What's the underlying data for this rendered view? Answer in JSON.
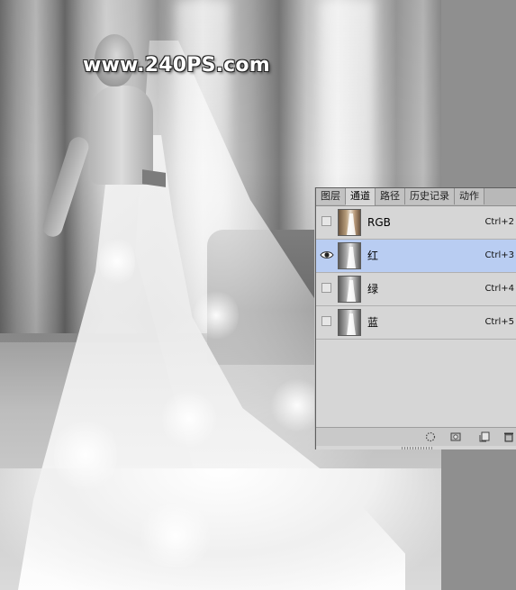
{
  "watermark": "www.240PS.com",
  "panel": {
    "tabs": [
      {
        "label": "图层",
        "active": false
      },
      {
        "label": "通道",
        "active": true
      },
      {
        "label": "路径",
        "active": false
      },
      {
        "label": "历史记录",
        "active": false
      },
      {
        "label": "动作",
        "active": false
      }
    ],
    "menu_icon": "panel-menu-icon",
    "channels": [
      {
        "name": "RGB",
        "shortcut": "Ctrl+2",
        "visible": false,
        "selected": false,
        "thumb": "color"
      },
      {
        "name": "红",
        "shortcut": "Ctrl+3",
        "visible": true,
        "selected": true,
        "thumb": "gray"
      },
      {
        "name": "绿",
        "shortcut": "Ctrl+4",
        "visible": false,
        "selected": false,
        "thumb": "gray"
      },
      {
        "name": "蓝",
        "shortcut": "Ctrl+5",
        "visible": false,
        "selected": false,
        "thumb": "gray"
      }
    ],
    "bottom_icons": [
      "load-selection-icon",
      "save-selection-icon",
      "new-channel-icon",
      "delete-channel-icon"
    ]
  },
  "colors": {
    "selected_row": "#b9cdf2",
    "panel_bg": "#d6d6d6"
  }
}
